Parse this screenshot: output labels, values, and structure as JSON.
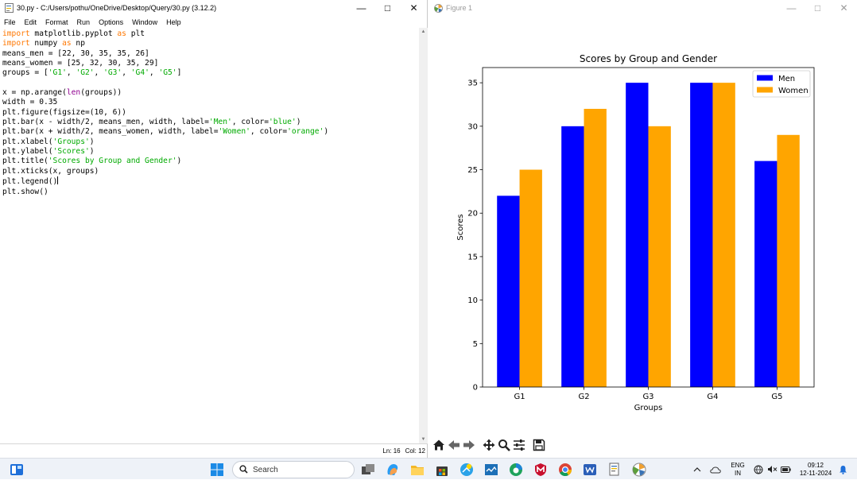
{
  "idle_window": {
    "title": "30.py - C:/Users/pothu/OneDrive/Desktop/Query/30.py (3.12.2)",
    "menu": [
      "File",
      "Edit",
      "Format",
      "Run",
      "Options",
      "Window",
      "Help"
    ],
    "status": {
      "line": "Ln: 16",
      "col": "Col: 12"
    }
  },
  "code": {
    "lines": [
      "import matplotlib.pyplot as plt",
      "import numpy as np",
      "means_men = [22, 30, 35, 35, 26]",
      "means_women = [25, 32, 30, 35, 29]",
      "groups = ['G1', 'G2', 'G3', 'G4', 'G5']",
      "",
      "x = np.arange(len(groups))",
      "width = 0.35",
      "plt.figure(figsize=(10, 6))",
      "plt.bar(x - width/2, means_men, width, label='Men', color='blue')",
      "plt.bar(x + width/2, means_women, width, label='Women', color='orange')",
      "plt.xlabel('Groups')",
      "plt.ylabel('Scores')",
      "plt.title('Scores by Group and Gender')",
      "plt.xticks(x, groups)",
      "plt.legend()",
      "plt.show()"
    ],
    "cursor": {
      "line": 16,
      "col": 12
    }
  },
  "figure_window": {
    "title": "Figure 1",
    "toolbar": [
      "home-icon",
      "back-icon",
      "forward-icon",
      "pan-icon",
      "zoom-icon",
      "configure-icon",
      "save-icon"
    ]
  },
  "chart_data": {
    "type": "bar",
    "title": "Scores by Group and Gender",
    "xlabel": "Groups",
    "ylabel": "Scores",
    "categories": [
      "G1",
      "G2",
      "G3",
      "G4",
      "G5"
    ],
    "series": [
      {
        "name": "Men",
        "values": [
          22,
          30,
          35,
          35,
          26
        ],
        "color": "#0000ff"
      },
      {
        "name": "Women",
        "values": [
          25,
          32,
          30,
          35,
          29
        ],
        "color": "#ffa500"
      }
    ],
    "ylim": [
      0,
      36.75
    ],
    "yticks": [
      0,
      5,
      10,
      15,
      20,
      25,
      30,
      35
    ],
    "legend": "top-right",
    "grid": false
  },
  "taskbar": {
    "search_placeholder": "Search",
    "language": "ENG",
    "region": "IN",
    "time": "09:12",
    "date": "12-11-2024"
  }
}
